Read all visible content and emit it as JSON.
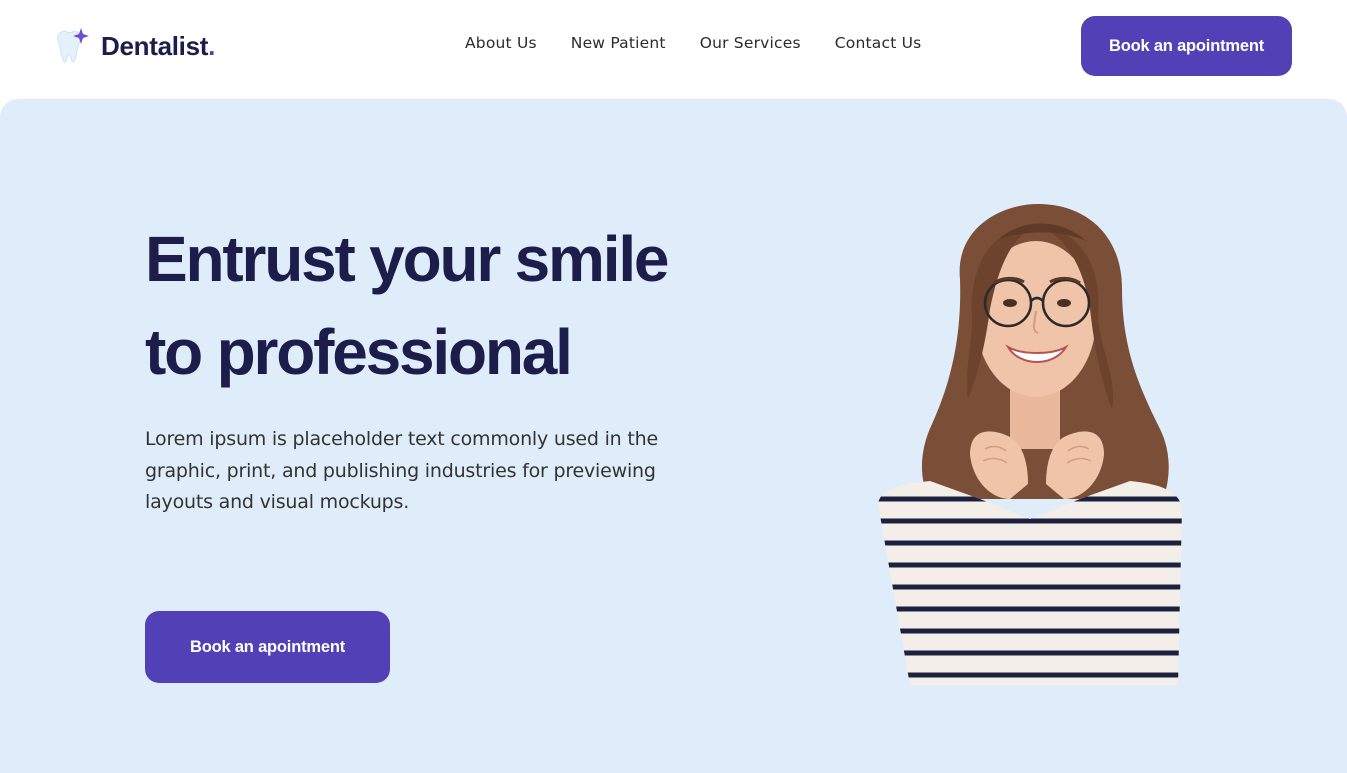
{
  "brand": {
    "name": "Dentalist",
    "dot": ".",
    "accent_color": "#5241b6",
    "text_color": "#1c1d4a",
    "logo_icon": "tooth-sparkle-icon"
  },
  "nav": {
    "items": [
      {
        "label": "About Us"
      },
      {
        "label": "New Patient"
      },
      {
        "label": "Our Services"
      },
      {
        "label": "Contact Us"
      }
    ]
  },
  "header": {
    "cta_label": "Book an apointment"
  },
  "hero": {
    "title_line1": "Entrust your smile",
    "title_line2": "to professional",
    "description": "Lorem ipsum is placeholder text commonly used in the graphic, print, and publishing industries for previewing layouts and visual mockups.",
    "cta_label": "Book an apointment",
    "background_color": "#dfecf9"
  }
}
